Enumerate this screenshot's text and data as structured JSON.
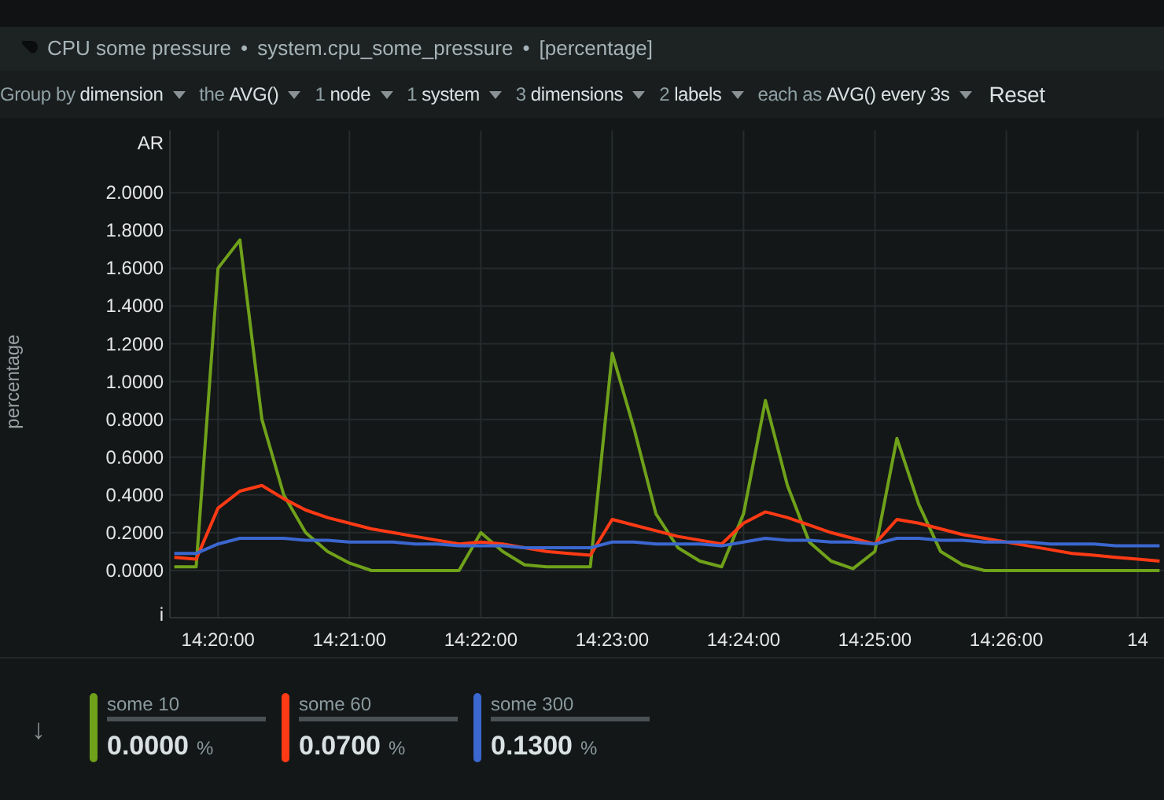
{
  "title": {
    "name": "CPU some pressure",
    "context": "system.cpu_some_pressure",
    "units": "[percentage]",
    "separator": "•"
  },
  "toolbar": [
    {
      "prefix": "Group by",
      "value": "dimension"
    },
    {
      "prefix": "the",
      "value": "AVG()"
    },
    {
      "prefix": "1",
      "value": "node"
    },
    {
      "prefix": "1",
      "value": "system"
    },
    {
      "prefix": "3",
      "value": "dimensions"
    },
    {
      "prefix": "2",
      "value": "labels"
    },
    {
      "prefix": "each as",
      "value": "AVG() every 3s"
    }
  ],
  "reset": "Reset",
  "chart": {
    "top_mark": "AR",
    "bottom_mark": "i",
    "chart_data": {
      "type": "line",
      "grid": true,
      "ylabel": "percentage",
      "ylim": [
        -0.25,
        2.33
      ],
      "yticks": [
        {
          "value": 0,
          "label": "0.0000"
        },
        {
          "value": 0.2,
          "label": "0.2000"
        },
        {
          "value": 0.4,
          "label": "0.4000"
        },
        {
          "value": 0.6,
          "label": "0.6000"
        },
        {
          "value": 0.8,
          "label": "0.8000"
        },
        {
          "value": 1,
          "label": "1.0000"
        },
        {
          "value": 1.2,
          "label": "1.2000"
        },
        {
          "value": 1.4,
          "label": "1.4000"
        },
        {
          "value": 1.6,
          "label": "1.6000"
        },
        {
          "value": 1.8,
          "label": "1.8000"
        },
        {
          "value": 2,
          "label": "2.0000"
        }
      ],
      "categories": [
        null,
        null,
        "14:20:00",
        null,
        null,
        null,
        null,
        null,
        "14:21:00",
        null,
        null,
        null,
        null,
        null,
        "14:22:00",
        null,
        null,
        null,
        null,
        null,
        "14:23:00",
        null,
        null,
        null,
        null,
        null,
        "14:24:00",
        null,
        null,
        null,
        null,
        null,
        "14:25:00",
        null,
        null,
        null,
        null,
        null,
        "14:26:00",
        null,
        null,
        null,
        null,
        null,
        "14",
        null
      ],
      "series": [
        {
          "name": "some 10",
          "color": "#6fa11a",
          "values": [
            0.02,
            0.02,
            1.6,
            1.75,
            0.8,
            0.4,
            0.2,
            0.1,
            0.04,
            0,
            0,
            0,
            0,
            0,
            0.2,
            0.1,
            0.03,
            0.02,
            0.02,
            0.02,
            1.15,
            0.75,
            0.3,
            0.12,
            0.05,
            0.02,
            0.3,
            0.9,
            0.45,
            0.15,
            0.05,
            0.01,
            0.1,
            0.7,
            0.35,
            0.1,
            0.03,
            0,
            0,
            0,
            0,
            0,
            0,
            0,
            0,
            0
          ]
        },
        {
          "name": "some 60",
          "color": "#ff3a14",
          "values": [
            0.07,
            0.06,
            0.33,
            0.42,
            0.45,
            0.38,
            0.32,
            0.28,
            0.25,
            0.22,
            0.2,
            0.18,
            0.16,
            0.14,
            0.15,
            0.14,
            0.12,
            0.1,
            0.09,
            0.08,
            0.27,
            0.24,
            0.21,
            0.18,
            0.16,
            0.14,
            0.25,
            0.31,
            0.28,
            0.24,
            0.2,
            0.17,
            0.14,
            0.27,
            0.25,
            0.22,
            0.19,
            0.17,
            0.15,
            0.13,
            0.11,
            0.09,
            0.08,
            0.07,
            0.06,
            0.05
          ]
        },
        {
          "name": "some 300",
          "color": "#3b67d0",
          "values": [
            0.09,
            0.09,
            0.14,
            0.17,
            0.17,
            0.17,
            0.16,
            0.16,
            0.15,
            0.15,
            0.15,
            0.14,
            0.14,
            0.13,
            0.13,
            0.13,
            0.12,
            0.12,
            0.12,
            0.12,
            0.15,
            0.15,
            0.14,
            0.14,
            0.14,
            0.13,
            0.15,
            0.17,
            0.16,
            0.16,
            0.15,
            0.15,
            0.14,
            0.17,
            0.17,
            0.16,
            0.16,
            0.15,
            0.15,
            0.15,
            0.14,
            0.14,
            0.14,
            0.13,
            0.13,
            0.13
          ]
        }
      ]
    }
  },
  "legend": {
    "arrow": "↓",
    "items": [
      {
        "value": "0.0000",
        "unit": "%"
      },
      {
        "value": "0.0700",
        "unit": "%"
      },
      {
        "value": "0.1300",
        "unit": "%"
      }
    ]
  }
}
